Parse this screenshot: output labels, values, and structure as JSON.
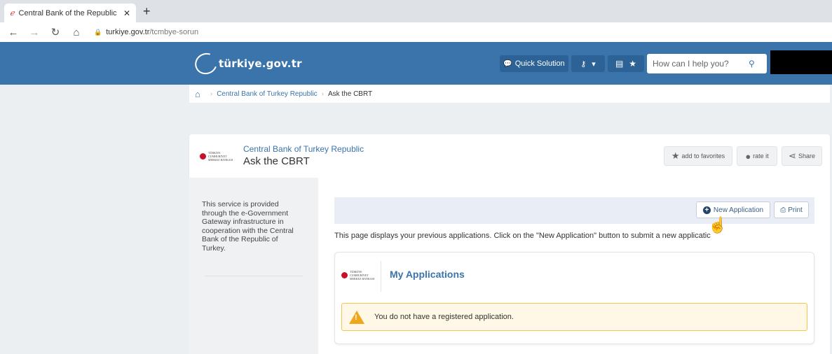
{
  "browser": {
    "tab_title": "Central Bank of the Republic of T",
    "new_tab": "+",
    "url_domain": "turkiye.gov.tr",
    "url_path": "/tcmbye-sorun"
  },
  "header": {
    "brand": "türkiye.gov.tr",
    "quick_solution": "Quick Solution",
    "search_placeholder": "How can I help you?"
  },
  "breadcrumb": {
    "items": [
      "Central Bank of Turkey Republic",
      "Ask the CBRT"
    ]
  },
  "service": {
    "org": "Central Bank of Turkey Republic",
    "name": "Ask the CBRT",
    "logo_text": "TÜRKİYE CUMHURİYET MERKEZ BANKASI",
    "actions": {
      "favorites": "add to favorites",
      "rate": "rate it",
      "share": "Share"
    }
  },
  "sidebar": {
    "info": "This service is provided through the e-Government Gateway infrastructure in cooperation with the Central Bank of the Republic of Turkey."
  },
  "main": {
    "new_application": "New Application",
    "print": "Print",
    "description": "This page displays your previous applications. Click on the \"New Application\" button to submit a new applicatic",
    "card_title": "My Applications",
    "warning": "You do not have a registered application."
  },
  "colors": {
    "header_blue": "#3b74aa",
    "warning_orange": "#f0a71c"
  }
}
